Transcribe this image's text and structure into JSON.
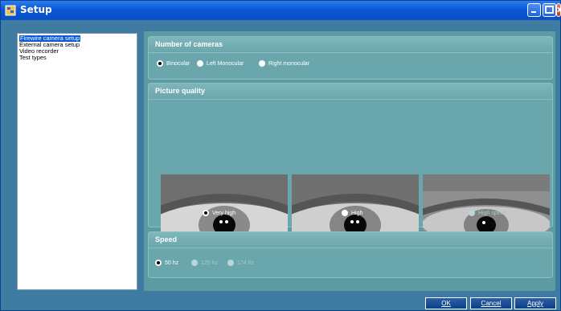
{
  "window": {
    "title": "Setup",
    "icons": {
      "app": "setup-app-icon",
      "minimize": "minimize-icon",
      "maximize": "maximize-icon",
      "close": "close-icon"
    }
  },
  "tree": {
    "items": [
      {
        "label": "Firewire camera setup",
        "selected": true
      },
      {
        "label": "External camera setup"
      },
      {
        "label": "Video recorder"
      },
      {
        "label": "Test types"
      }
    ]
  },
  "cameras": {
    "header": "Number of cameras",
    "options": [
      {
        "label": "Binocular",
        "checked": true
      },
      {
        "label": "Left Monocular"
      },
      {
        "label": "Right monocular"
      }
    ]
  },
  "quality": {
    "header": "Picture quality",
    "options": [
      {
        "label": "Very high",
        "checked": true
      },
      {
        "label": "High"
      },
      {
        "label": "High speed",
        "disabled": true
      }
    ]
  },
  "speed": {
    "header": "Speed",
    "options": [
      {
        "label": "50 hz",
        "checked": true
      },
      {
        "label": "120 hz",
        "disabled": true
      },
      {
        "label": "174 hz",
        "disabled": true
      }
    ]
  },
  "buttons": {
    "ok": "OK",
    "cancel": "Cancel",
    "apply": "Apply"
  }
}
